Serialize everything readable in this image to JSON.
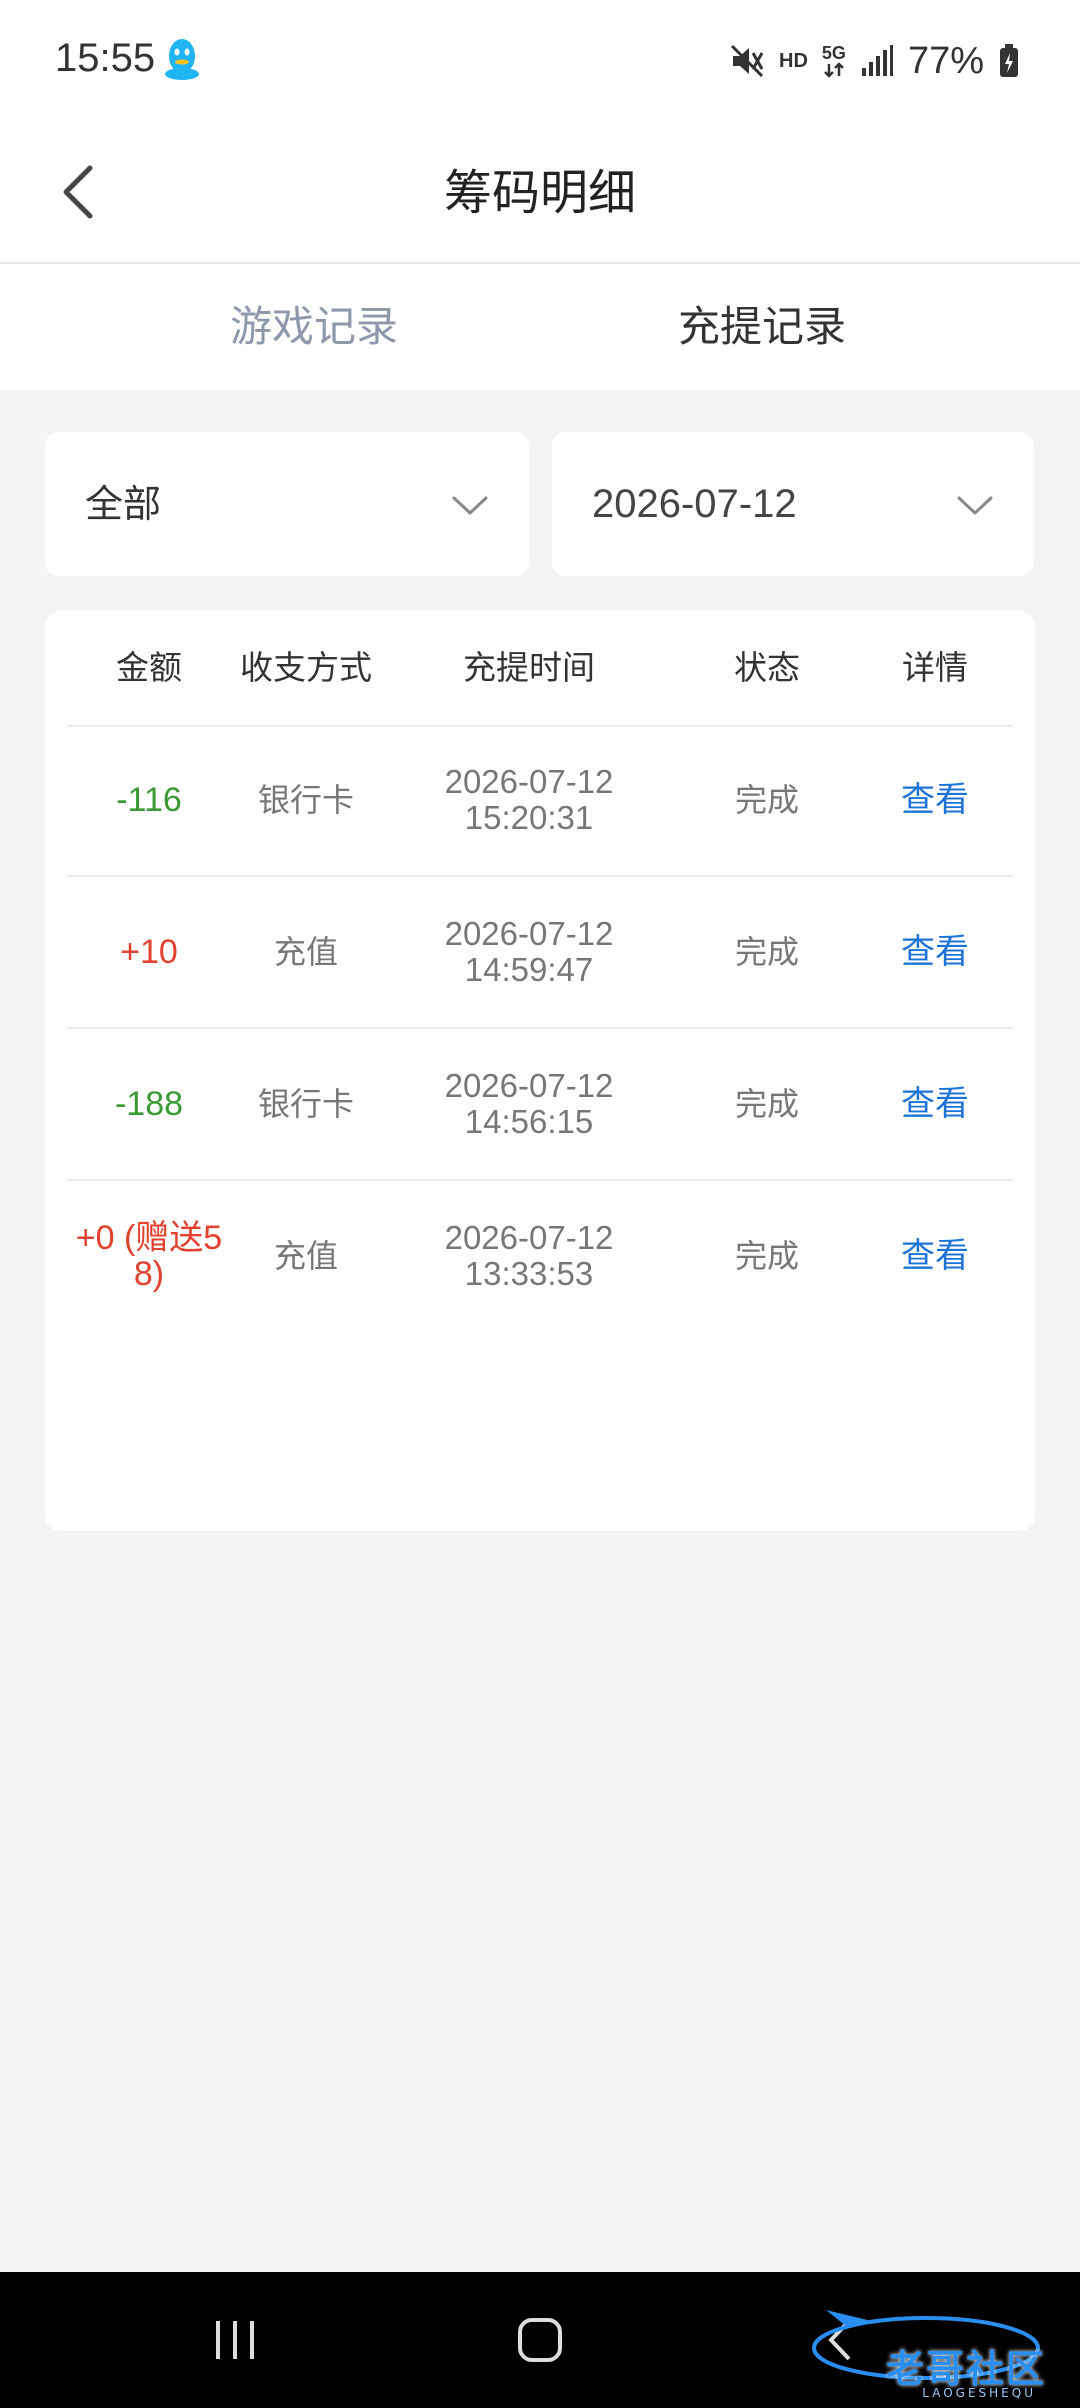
{
  "status_bar": {
    "time": "15:55",
    "network": "5G",
    "hd": "HD",
    "battery": "77%"
  },
  "header": {
    "title": "筹码明细"
  },
  "tabs": [
    {
      "label": "游戏记录",
      "active": false
    },
    {
      "label": "充提记录",
      "active": true
    }
  ],
  "filters": {
    "type": "全部",
    "date": "2026-07-12"
  },
  "table": {
    "columns": [
      "金额",
      "收支方式",
      "充提时间",
      "状态",
      "详情"
    ],
    "rows": [
      {
        "amount": "-116",
        "method": "银行卡",
        "date": "2026-07-12",
        "time": "15:20:31",
        "status": "完成",
        "detail": "查看"
      },
      {
        "amount": "+10",
        "method": "充值",
        "date": "2026-07-12",
        "time": "14:59:47",
        "status": "完成",
        "detail": "查看"
      },
      {
        "amount": "-188",
        "method": "银行卡",
        "date": "2026-07-12",
        "time": "14:56:15",
        "status": "完成",
        "detail": "查看"
      },
      {
        "amount": "+0 (赠送58)",
        "amount_line1": "+0 (赠送5",
        "amount_line2": "8)",
        "method": "充值",
        "date": "2026-07-12",
        "time": "13:33:53",
        "status": "完成",
        "detail": "查看"
      }
    ]
  },
  "watermark": {
    "text": "老哥社区",
    "sub": "LAOGESHEQU"
  },
  "colors": {
    "negative": "#3a9a35",
    "positive": "#e1412e",
    "link": "#1e73d6",
    "tab_inactive": "#8e98aa"
  }
}
